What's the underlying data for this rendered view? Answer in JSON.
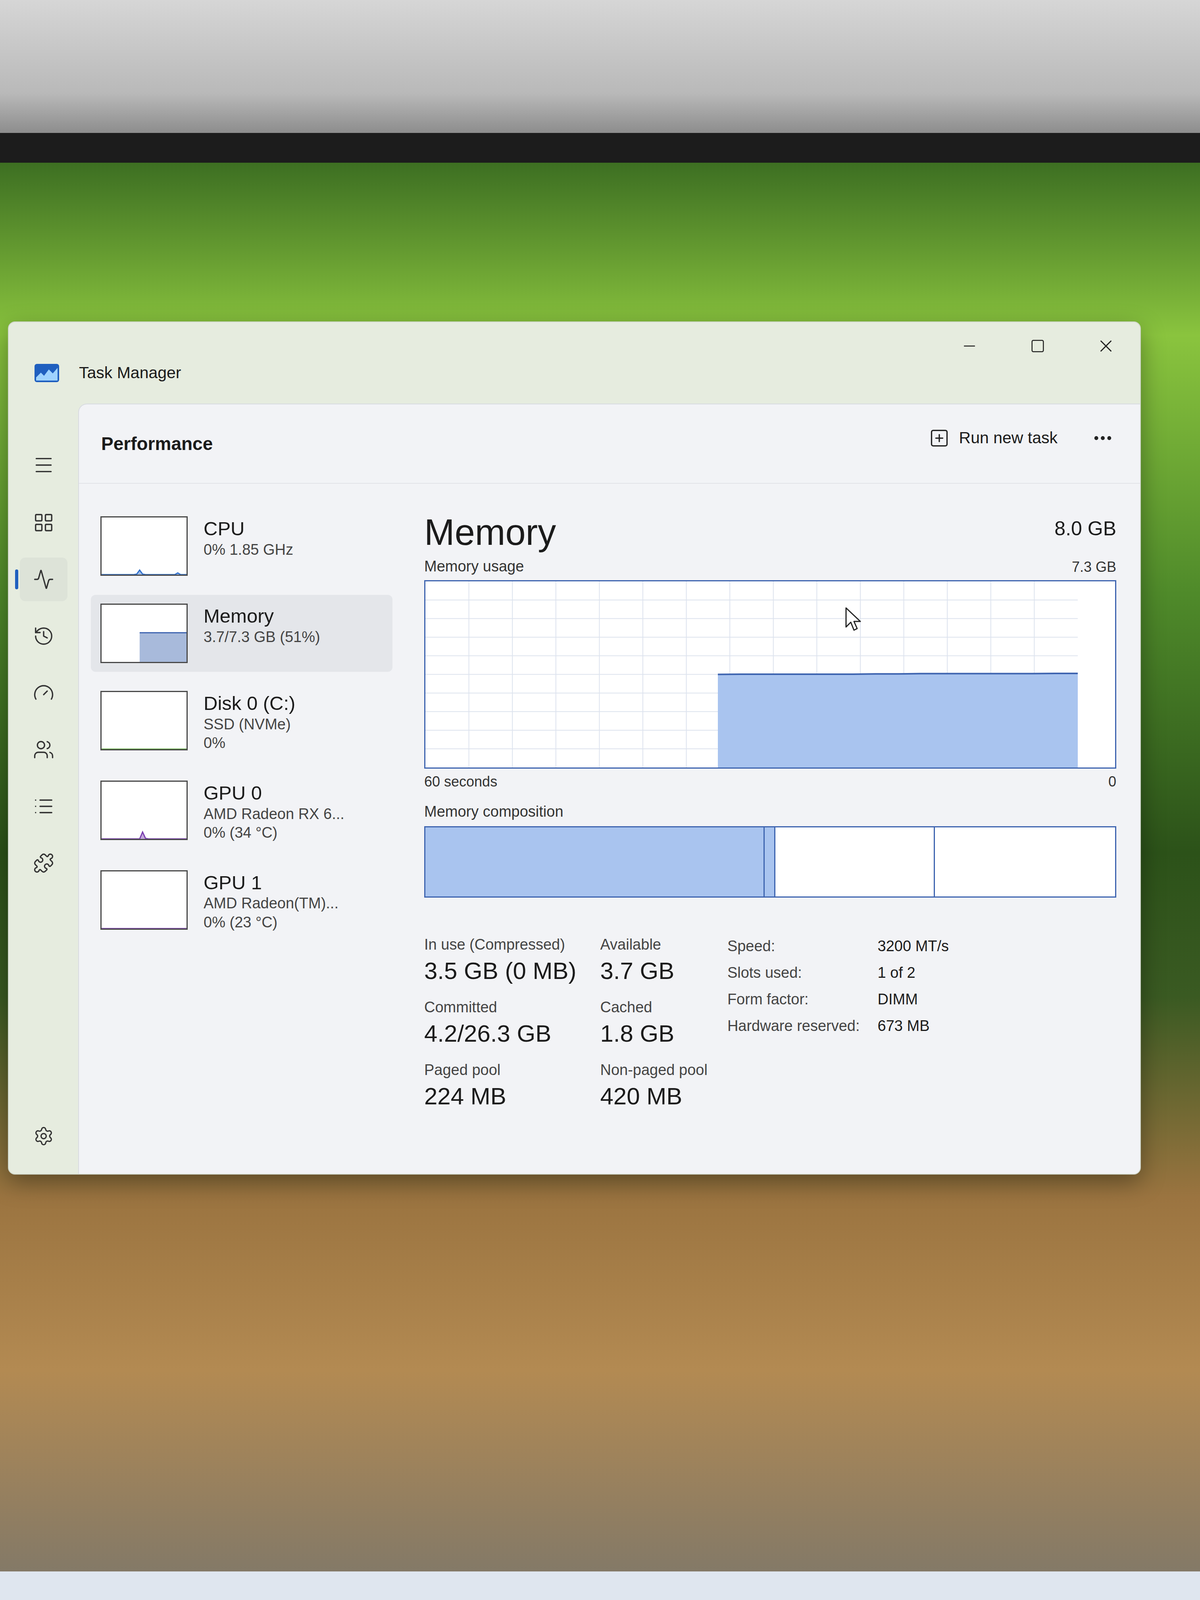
{
  "window": {
    "title": "Task Manager"
  },
  "nav": [
    {
      "selected": false
    },
    {
      "selected": true
    },
    {
      "selected": false
    },
    {
      "selected": false
    },
    {
      "selected": false
    },
    {
      "selected": false
    },
    {
      "selected": false
    }
  ],
  "header": {
    "title": "Performance",
    "run_new_task": "Run new task"
  },
  "resources": [
    {
      "name": "CPU",
      "details": [
        "0% 1.85 GHz"
      ],
      "selected": false,
      "color": "#2f6fcc",
      "graph": [
        0,
        0,
        0,
        0,
        0,
        0,
        0,
        0,
        0,
        0,
        0,
        0,
        1,
        8,
        1,
        0,
        0,
        0,
        0,
        0,
        0,
        0,
        0,
        0,
        0,
        0,
        3,
        0,
        0,
        0
      ]
    },
    {
      "name": "Memory",
      "details": [
        "3.7/7.3 GB (51%)"
      ],
      "selected": true,
      "color": "#3f65b0",
      "graph": [
        null,
        null,
        null,
        null,
        null,
        null,
        null,
        null,
        null,
        null,
        null,
        null,
        null,
        51,
        51,
        51,
        51,
        51,
        51,
        51,
        51,
        51,
        51,
        51,
        51,
        51,
        51,
        51,
        51,
        51
      ]
    },
    {
      "name": "Disk 0 (C:)",
      "details": [
        "SSD (NVMe)",
        "0%"
      ],
      "selected": false,
      "color": "#4c9a2a",
      "graph": [
        0,
        0,
        0,
        0,
        0,
        0,
        0,
        0,
        0,
        0,
        0,
        0,
        0,
        0,
        0,
        0,
        0,
        0,
        0,
        0,
        0,
        0,
        0,
        0,
        0,
        0,
        0,
        0,
        0,
        0
      ]
    },
    {
      "name": "GPU 0",
      "details": [
        "AMD Radeon RX 6...",
        "0% (34 °C)"
      ],
      "selected": false,
      "color": "#7a3fb0",
      "graph": [
        0,
        0,
        0,
        0,
        0,
        0,
        0,
        0,
        0,
        0,
        0,
        0,
        0,
        0,
        12,
        1,
        0,
        0,
        0,
        0,
        0,
        0,
        0,
        0,
        0,
        0,
        0,
        0,
        0,
        0
      ]
    },
    {
      "name": "GPU 1",
      "details": [
        "AMD Radeon(TM)...",
        "0% (23 °C)"
      ],
      "selected": false,
      "color": "#7a3fb0",
      "graph": [
        0,
        0,
        0,
        0,
        0,
        0,
        0,
        0,
        0,
        0,
        0,
        0,
        0,
        0,
        0,
        0,
        0,
        0,
        0,
        0,
        0,
        0,
        0,
        0,
        0,
        0,
        0,
        0,
        0,
        0
      ]
    }
  ],
  "memory": {
    "title": "Memory",
    "total": "8.0 GB",
    "usage_label": "Memory usage",
    "usage_max": "7.3 GB",
    "time_span": "60 seconds",
    "axis_min": "0",
    "usage_series": [
      null,
      null,
      null,
      null,
      null,
      null,
      null,
      null,
      null,
      null,
      null,
      null,
      null,
      3.65,
      3.66,
      3.66,
      3.66,
      3.66,
      3.66,
      3.66,
      3.67,
      3.67,
      3.68,
      3.68,
      3.68,
      3.68,
      3.68,
      3.68,
      3.69,
      3.69
    ],
    "composition_label": "Memory composition",
    "composition": [
      {
        "level": 0.49,
        "filled": true
      },
      {
        "level": 0.016,
        "filled": true
      },
      {
        "level": 0.231,
        "filled": false
      },
      {
        "level": 0.263,
        "filled": false
      }
    ],
    "stats": [
      {
        "label": "In use (Compressed)",
        "value": "3.5 GB (0 MB)"
      },
      {
        "label": "Available",
        "value": "3.7 GB"
      },
      {
        "label": "Committed",
        "value": "4.2/26.3 GB"
      },
      {
        "label": "Cached",
        "value": "1.8 GB"
      },
      {
        "label": "Paged pool",
        "value": "224 MB"
      },
      {
        "label": "Non-paged pool",
        "value": "420 MB"
      }
    ],
    "specs": [
      {
        "label": "Speed:",
        "value": "3200 MT/s"
      },
      {
        "label": "Slots used:",
        "value": "1 of 2"
      },
      {
        "label": "Form factor:",
        "value": "DIMM"
      },
      {
        "label": "Hardware reserved:",
        "value": "673 MB"
      }
    ]
  }
}
